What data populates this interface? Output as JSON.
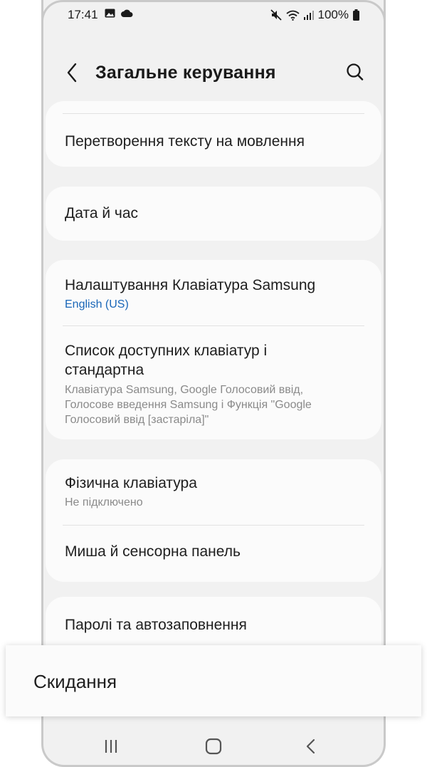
{
  "status_bar": {
    "time": "17:41",
    "left_icons": [
      "image-icon",
      "cloud-icon"
    ],
    "right_icons": [
      "mute-icon",
      "wifi-icon",
      "signal-icon"
    ],
    "battery": "100%"
  },
  "header": {
    "title": "Загальне керування",
    "back_icon": "back-arrow-icon",
    "search_icon": "search-icon"
  },
  "groups": [
    {
      "items": [
        {
          "title": "Перетворення тексту на мовлення"
        }
      ]
    },
    {
      "items": [
        {
          "title": "Дата й час"
        }
      ]
    },
    {
      "items": [
        {
          "title": "Налаштування Клавіатура Samsung",
          "subtitle": "English (US)"
        },
        {
          "title_line1": "Список доступних клавіатур і",
          "title_line2": "стандартна",
          "subtitle_line1": "Клавіатура Samsung, Google Голосовий ввід,",
          "subtitle_line2": "Голосове введення Samsung і Функція \"Google",
          "subtitle_line3": "Голосовий ввід [застаріла]\""
        }
      ]
    },
    {
      "items": [
        {
          "title": "Фізична клавіатура",
          "subtitle": "Не підключено"
        },
        {
          "title": "Миша й сенсорна панель"
        }
      ]
    },
    {
      "items": [
        {
          "title": "Паролі та автозаповнення"
        }
      ]
    }
  ],
  "reset": {
    "label": "Скидання"
  },
  "navbar": {
    "recent_icon": "recent-apps-icon",
    "home_icon": "home-icon",
    "back_icon": "nav-back-icon"
  },
  "colors": {
    "accent": "#1866b8",
    "background": "#f1f1f1",
    "card": "#fbfbfb"
  }
}
